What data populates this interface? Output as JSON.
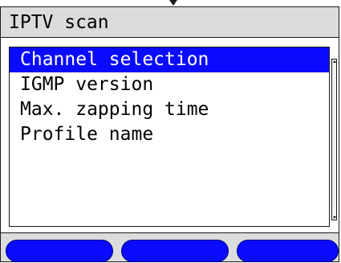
{
  "title_bar": {
    "title": "IPTV scan"
  },
  "menu": {
    "items": [
      {
        "label": "Channel selection",
        "selected": true
      },
      {
        "label": "IGMP version",
        "selected": false
      },
      {
        "label": "Max. zapping time",
        "selected": false
      },
      {
        "label": "Profile name",
        "selected": false
      }
    ]
  },
  "softkeys": [
    {
      "label": ""
    },
    {
      "label": ""
    },
    {
      "label": ""
    }
  ],
  "colors": {
    "selection": "#0a0aff",
    "softkey": "#0a0aff",
    "title_background": "#dcdcdc"
  },
  "icons": {
    "top_indicator": "down-triangle-icon",
    "scroll_up": "scroll-up-arrow-icon",
    "scroll_down": "scroll-down-arrow-icon"
  }
}
